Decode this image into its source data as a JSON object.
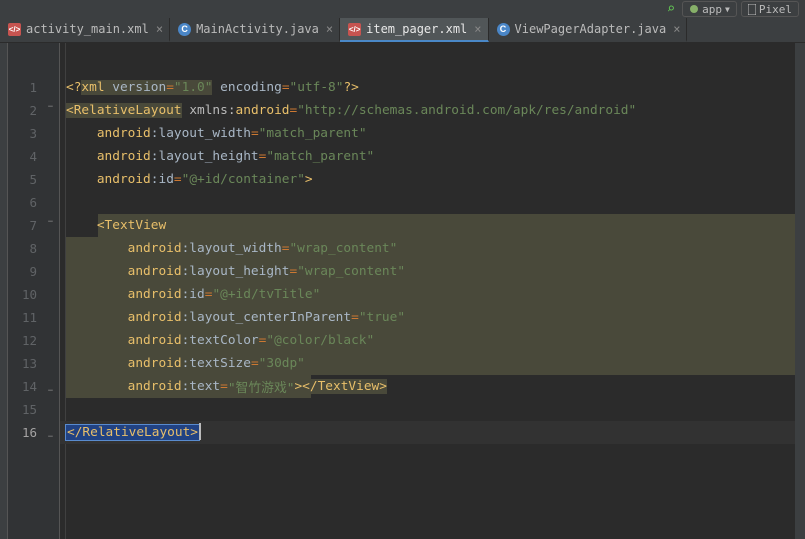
{
  "toolbar": {
    "run_target": "app",
    "device_btn": "Pixel"
  },
  "tabs": [
    {
      "label": "activity_main.xml",
      "icon": "xml",
      "icon_text": "</>",
      "active": false
    },
    {
      "label": "MainActivity.java",
      "icon": "java",
      "icon_text": "C",
      "active": false
    },
    {
      "label": "item_pager.xml",
      "icon": "xml",
      "icon_text": "</>",
      "active": true
    },
    {
      "label": "ViewPagerAdapter.java",
      "icon": "java",
      "icon_text": "C",
      "active": false
    }
  ],
  "gutter": {
    "from": 1,
    "to": 16,
    "current": 16
  },
  "code": {
    "l1": {
      "pi1": "<?",
      "pi2": "xml",
      "sp1": " ",
      "a1": "version",
      "eq": "=",
      "v1": "\"1.0\"",
      "sp2": " ",
      "a2": "encoding",
      "v2": "\"utf-8\"",
      "pi3": "?>"
    },
    "l2": {
      "open": "<",
      "tag": "RelativeLayout",
      "sp": " ",
      "xmlns": "xmlns:",
      "ns": "android",
      "eq": "=",
      "url": "\"http://schemas.android.com/apk/res/android\""
    },
    "l3": {
      "indent": "    ",
      "ns": "android",
      "col": ":",
      "attr": "layout_width",
      "eq": "=",
      "val": "\"match_parent\""
    },
    "l4": {
      "indent": "    ",
      "ns": "android",
      "col": ":",
      "attr": "layout_height",
      "eq": "=",
      "val": "\"match_parent\""
    },
    "l5": {
      "indent": "    ",
      "ns": "android",
      "col": ":",
      "attr": "id",
      "eq": "=",
      "val": "\"@+id/container\"",
      "close": ">"
    },
    "l7": {
      "indent": "    ",
      "open": "<",
      "tag": "TextView"
    },
    "l8": {
      "indent": "        ",
      "ns": "android",
      "col": ":",
      "attr": "layout_width",
      "eq": "=",
      "val": "\"wrap_content\""
    },
    "l9": {
      "indent": "        ",
      "ns": "android",
      "col": ":",
      "attr": "layout_height",
      "eq": "=",
      "val": "\"wrap_content\""
    },
    "l10": {
      "indent": "        ",
      "ns": "android",
      "col": ":",
      "attr": "id",
      "eq": "=",
      "val": "\"@+id/tvTitle\""
    },
    "l11": {
      "indent": "        ",
      "ns": "android",
      "col": ":",
      "attr": "layout_centerInParent",
      "eq": "=",
      "val": "\"true\""
    },
    "l12": {
      "indent": "        ",
      "ns": "android",
      "col": ":",
      "attr": "textColor",
      "eq": "=",
      "val": "\"@color/black\""
    },
    "l13": {
      "indent": "        ",
      "ns": "android",
      "col": ":",
      "attr": "textSize",
      "eq": "=",
      "val": "\"30dp\""
    },
    "l14": {
      "indent": "        ",
      "ns": "android",
      "col": ":",
      "attr": "text",
      "eq": "=",
      "val": "\"智竹游戏\"",
      "close1": ">",
      "close2": "</",
      "close3": "TextView",
      "close4": ">"
    },
    "l16": {
      "open": "</",
      "tag": "RelativeLayout",
      "close": ">"
    }
  }
}
